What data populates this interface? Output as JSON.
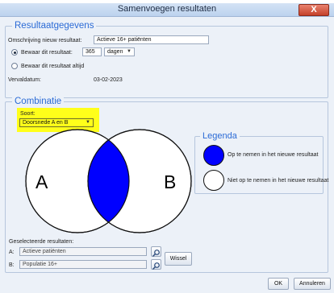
{
  "window": {
    "title": "Samenvoegen resultaten",
    "close_label": "X"
  },
  "resultaat": {
    "section_title": "Resultaatgegevens",
    "omschrijving_label": "Omschrijving nieuw resultaat:",
    "omschrijving_value": "Actieve 16+ patiënten",
    "bewaar_label": "Bewaar dit resultaat:",
    "bewaar_value": "365",
    "bewaar_unit": "dagen",
    "bewaar_altijd_label": "Bewaar dit resultaat altijd",
    "bewaar_selected": "days",
    "vervaldatum_label": "Vervaldatum:",
    "vervaldatum_value": "03-02-2023"
  },
  "combinatie": {
    "section_title": "Combinatie",
    "soort_label": "Soort:",
    "soort_value": "Doorsnede A en B",
    "venn": {
      "label_a": "A",
      "label_b": "B",
      "highlight_color": "#0000ff"
    },
    "legenda": {
      "title": "Legenda",
      "items": [
        {
          "label": "Op te nemen in het nieuwe resultaat",
          "color": "#0000ff"
        },
        {
          "label": "Niet op te nemen in het nieuwe resultaat",
          "color": "#ffffff"
        }
      ]
    },
    "geselecteerde_label": "Geselecteerde resultaten:",
    "a_label": "A:",
    "a_value": "Actieve patiënten",
    "b_label": "B:",
    "b_value": "Populatie 16+",
    "wissel_label": "Wissel"
  },
  "footer": {
    "ok_label": "OK",
    "annuleren_label": "Annuleren"
  },
  "colors": {
    "accent": "#2b6bd6",
    "highlight": "#ffff1a",
    "venn_fill": "#0000ff"
  }
}
